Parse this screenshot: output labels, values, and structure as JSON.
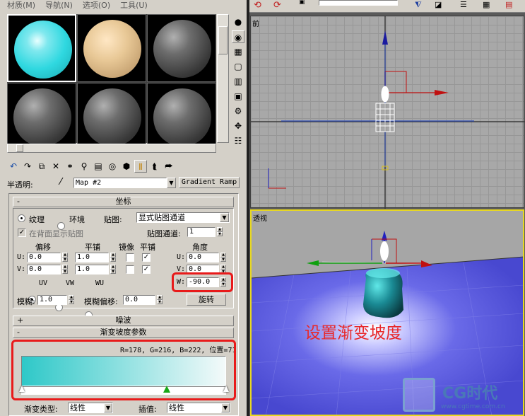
{
  "menu": [
    "材质(M)",
    "导航(N)",
    "选项(O)",
    "工具(U)"
  ],
  "material": {
    "transparency_label": "半透明:",
    "map_name": "Map #2",
    "map_type": "Gradient Ramp"
  },
  "coords": {
    "title": "坐标",
    "texture_label": "纹理",
    "env_label": "环境",
    "mapping_label": "贴图:",
    "mapping_value": "显式贴图通道",
    "show_back_label": "在背面显示贴图",
    "channel_label": "贴图通道:",
    "channel_value": "1",
    "offset_header": "偏移",
    "tiling_header": "平铺",
    "mirror_header": "镜像",
    "tile_header": "平铺",
    "angle_header": "角度",
    "u_label": "U:",
    "v_label": "V:",
    "w_label": "W:",
    "u_offset": "0.0",
    "v_offset": "0.0",
    "u_tiling": "1.0",
    "v_tiling": "1.0",
    "u_angle": "0.0",
    "v_angle": "0.0",
    "w_angle": "-90.0",
    "uv_label": "UV",
    "vw_label": "VW",
    "wu_label": "WU",
    "blur_label": "模糊:",
    "blur_value": "1.0",
    "blur_offset_label": "模糊偏移:",
    "blur_offset_value": "0.0",
    "rotate_label": "旋转"
  },
  "noise": {
    "title": "噪波"
  },
  "ramp": {
    "title": "渐变坡度参数",
    "info": "R=178, G=216, B=222, 位置=71",
    "type_label": "渐变类型:",
    "type_value": "线性",
    "interp_label": "插值:",
    "interp_value": "线性",
    "start_color": "#2ec8c8",
    "end_color": "#f4fafa",
    "marker_position": 0.71
  },
  "viewports": {
    "front_label": "前",
    "persp_label": "透视"
  },
  "annotation": "设置渐变坡度",
  "watermark": {
    "logo": "CG时代",
    "url": "www.cgtime.com.cn"
  }
}
